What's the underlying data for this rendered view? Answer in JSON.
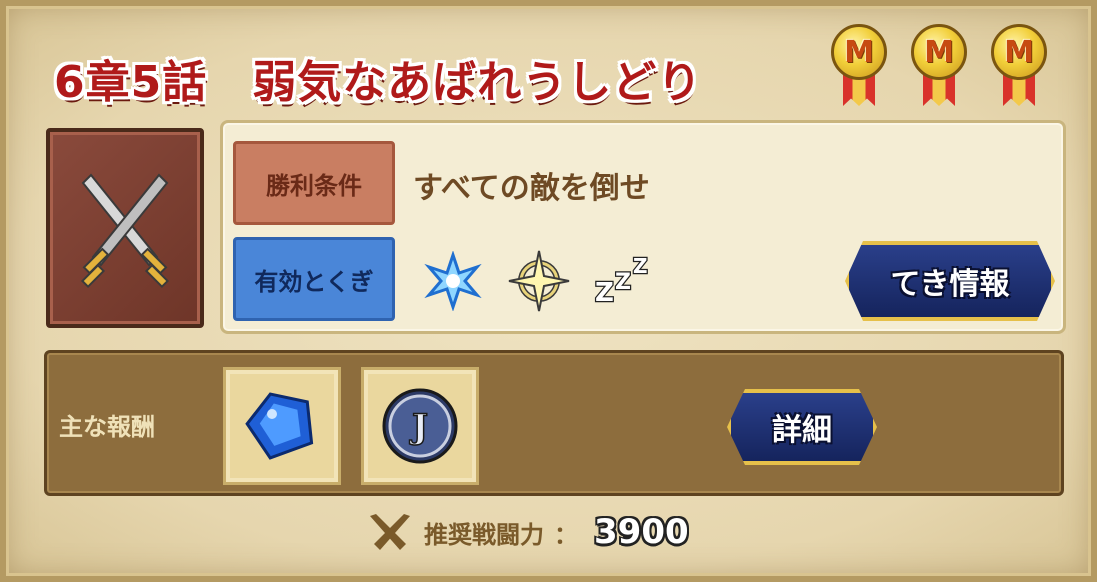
{
  "stage": {
    "title": "6章5話　弱気なあばれうしどり",
    "medal_letter": "M",
    "medals": 3
  },
  "conditions": {
    "victory_tag": "勝利条件",
    "victory_text": "すべての敵を倒せ",
    "weakness_tag": "有効とくぎ",
    "weakness_icons": [
      "ice-snowflake-icon",
      "light-star-icon",
      "sleep-zzz-icon"
    ]
  },
  "buttons": {
    "enemy_info": "てき情報",
    "detail": "詳細"
  },
  "rewards": {
    "label": "主な報酬",
    "items": [
      "blue-gem-icon",
      "j-coin-icon"
    ]
  },
  "recommended": {
    "label": "推奨戦闘力",
    "colon": "：",
    "value": "3900"
  },
  "colors": {
    "title_red": "#b01a1a",
    "victory_tag": "#c97e62",
    "weakness_tag": "#4a86d8",
    "button_navy": "#15245d",
    "button_gold": "#e6c04a"
  }
}
